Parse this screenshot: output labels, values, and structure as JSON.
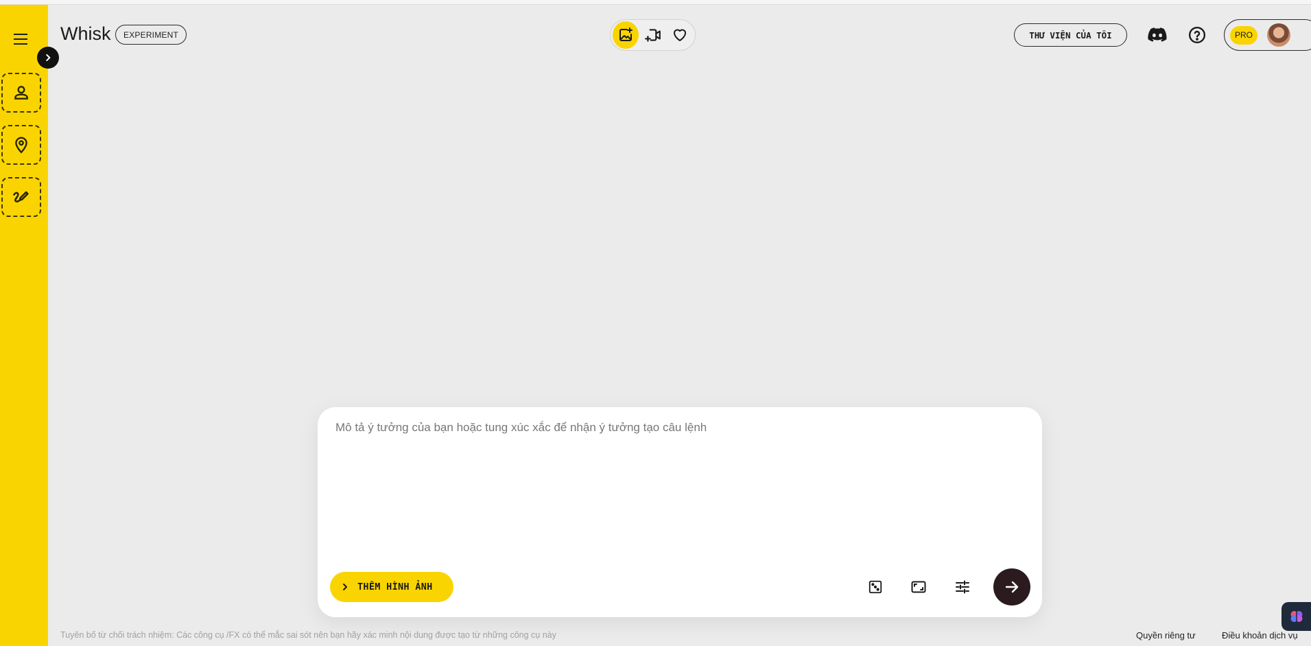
{
  "app": {
    "title": "Whisk",
    "badge": "EXPERIMENT",
    "accent_color": "#fad400"
  },
  "sidebar": {
    "menu_icon": "hamburger-menu-icon",
    "expand_icon": "chevron-right-icon",
    "slots": [
      {
        "name": "subject",
        "icon": "person-icon"
      },
      {
        "name": "scene",
        "icon": "location-pin-icon"
      },
      {
        "name": "style",
        "icon": "brush-icon"
      }
    ]
  },
  "header": {
    "modes": [
      {
        "name": "image",
        "icon": "add-image-icon",
        "active": true
      },
      {
        "name": "video",
        "icon": "video-icon",
        "active": false
      },
      {
        "name": "favorites",
        "icon": "heart-icon",
        "active": false
      }
    ],
    "library_label": "THƯ VIỆN CỦA TÔI",
    "discord_icon": "discord-icon",
    "help_icon": "help-icon",
    "pro_label": "PRO"
  },
  "prompt": {
    "placeholder": "Mô tả ý tưởng của bạn hoặc tung xúc xắc để nhận ý tưởng tạo câu lệnh",
    "value": "",
    "add_image_label": "THÊM HÌNH ẢNH",
    "tools": [
      "dice-icon",
      "aspect-ratio-icon",
      "settings-sliders-icon"
    ],
    "submit_icon": "arrow-right-icon"
  },
  "footer": {
    "disclaimer": "Tuyên bố từ chối trách nhiệm: Các công cụ /FX có thể mắc sai sót nên bạn hãy xác minh nội dung được tạo từ những công cụ này",
    "privacy": "Quyền riêng tư",
    "terms": "Điều khoản dịch vụ"
  }
}
